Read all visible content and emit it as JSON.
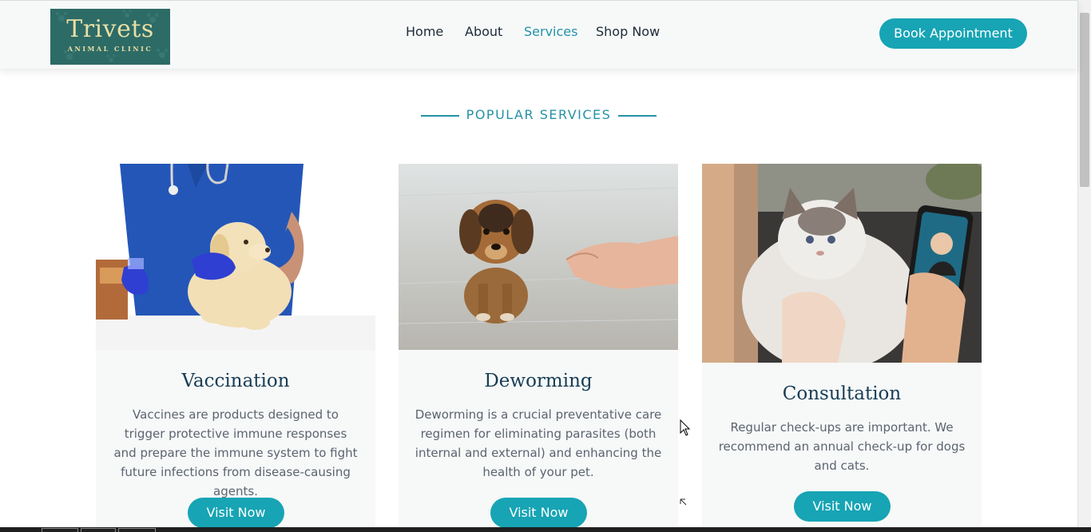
{
  "header": {
    "logo": {
      "title": "Trivets",
      "subtitle": "ANIMAL CLINIC"
    },
    "nav": [
      {
        "label": "Home",
        "active": false
      },
      {
        "label": "About",
        "active": false
      },
      {
        "label": "Services",
        "active": true
      },
      {
        "label": "Shop Now",
        "active": false
      }
    ],
    "book_label": "Book Appointment"
  },
  "section": {
    "heading": "POPULAR SERVICES"
  },
  "cards": [
    {
      "title": "Vaccination",
      "description": "Vaccines are products designed to trigger protective immune responses and prepare the immune system to fight future infections from disease-causing agents.",
      "button": "Visit Now",
      "image": "vet-holding-puppy"
    },
    {
      "title": "Deworming",
      "description": "Deworming is a crucial preventative care regimen for eliminating parasites (both internal and external) and enhancing the health of your pet.",
      "button": "Visit Now",
      "image": "puppy-and-hand"
    },
    {
      "title": "Consultation",
      "description": "Regular check-ups are important. We recommend an annual check-up for dogs and cats.",
      "button": "Visit Now",
      "image": "cat-video-call"
    }
  ],
  "colors": {
    "accent": "#17a4b4",
    "nav_active": "#2592a6",
    "heading": "#173d55",
    "logo_bg": "#2d6b66"
  }
}
